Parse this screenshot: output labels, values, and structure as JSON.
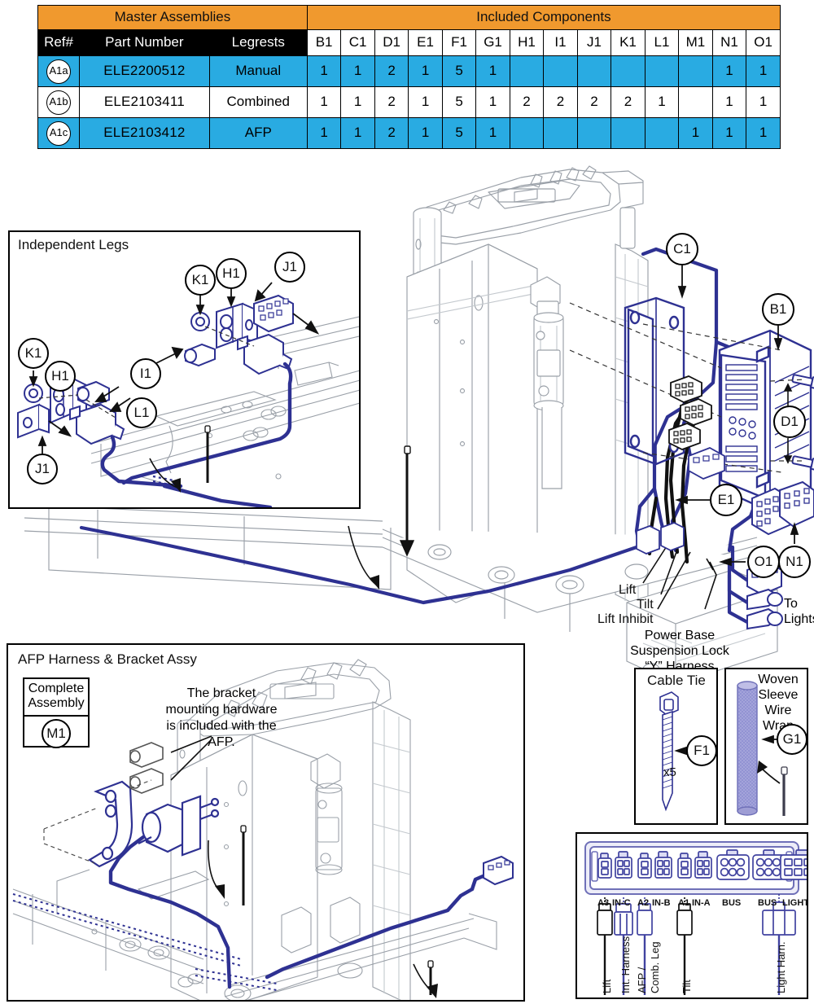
{
  "table": {
    "group_headers": [
      {
        "label": "Master Assemblies",
        "span": 3
      },
      {
        "label": "Included Components",
        "span": 14
      }
    ],
    "columns": [
      "Ref#",
      "Part Number",
      "Legrests",
      "B1",
      "C1",
      "D1",
      "E1",
      "F1",
      "G1",
      "H1",
      "I1",
      "J1",
      "K1",
      "L1",
      "M1",
      "N1",
      "O1"
    ],
    "rows": [
      {
        "ref": "A1a",
        "part_number": "ELE2200512",
        "legrests": "Manual",
        "qty": [
          "1",
          "1",
          "2",
          "1",
          "5",
          "1",
          "",
          "",
          "",
          "",
          "",
          "",
          "1",
          "1"
        ],
        "highlight": true
      },
      {
        "ref": "A1b",
        "part_number": "ELE2103411",
        "legrests": "Combined",
        "qty": [
          "1",
          "1",
          "2",
          "1",
          "5",
          "1",
          "2",
          "2",
          "2",
          "2",
          "1",
          "",
          "1",
          "1"
        ],
        "highlight": false
      },
      {
        "ref": "A1c",
        "part_number": "ELE2103412",
        "legrests": "AFP",
        "qty": [
          "1",
          "1",
          "2",
          "1",
          "5",
          "1",
          "",
          "",
          "",
          "",
          "",
          "1",
          "1",
          "1"
        ],
        "highlight": true
      }
    ],
    "colors": {
      "group_header_bg": "#F0992E",
      "column_header_bg": "#000000",
      "column_header_fg": "#FFFFFF",
      "row_highlight_bg": "#29ABE2",
      "row_plain_bg": "#FFFFFF",
      "border": "#000000"
    }
  },
  "independent_legs_panel": {
    "title": "Independent Legs",
    "callouts": [
      "K1",
      "H1",
      "J1",
      "K1",
      "H1",
      "I1",
      "L1",
      "J1"
    ]
  },
  "afp_panel": {
    "title": "AFP Harness & Bracket Assy",
    "complete_assembly": {
      "line1": "Complete",
      "line2": "Assembly",
      "ref": "M1"
    },
    "note": "The bracket mounting hardware is included with the AFP.",
    "note_lines": [
      "The bracket",
      "mounting hardware",
      "is included with the",
      "AFP."
    ]
  },
  "main_diagram": {
    "callouts": [
      "C1",
      "B1",
      "D1",
      "E1",
      "N1",
      "O1"
    ],
    "wire_labels": [
      "Lift",
      "Tilt",
      "Lift Inhibit"
    ],
    "to_lights": [
      "To",
      "Lights"
    ],
    "y_harness_lines": [
      "Power Base",
      "Suspension Lock",
      "“Y” Harness"
    ]
  },
  "cable_tie_panel": {
    "title": "Cable Tie",
    "ref": "F1",
    "qty_label": "x5"
  },
  "woven_sleeve_panel": {
    "title_lines": [
      "Woven",
      "Sleeve",
      "Wire Wrap"
    ],
    "ref": "G1"
  },
  "connector_panel": {
    "ports": [
      "A3",
      "IN-C",
      "A2",
      "IN-B",
      "A1",
      "IN-A",
      "BUS",
      "BUS",
      "LIGHT"
    ],
    "wire_labels": [
      "Lift",
      "Int. Harness",
      "AFP /",
      "Comb. Leg",
      "Tilt",
      "Light Harn."
    ]
  },
  "colors": {
    "navy": "#2E3192",
    "periwinkle": "#8D8FD1",
    "line_gray": "#9AA0A8",
    "line_gray_light": "#C4C9CE",
    "black": "#000000"
  }
}
